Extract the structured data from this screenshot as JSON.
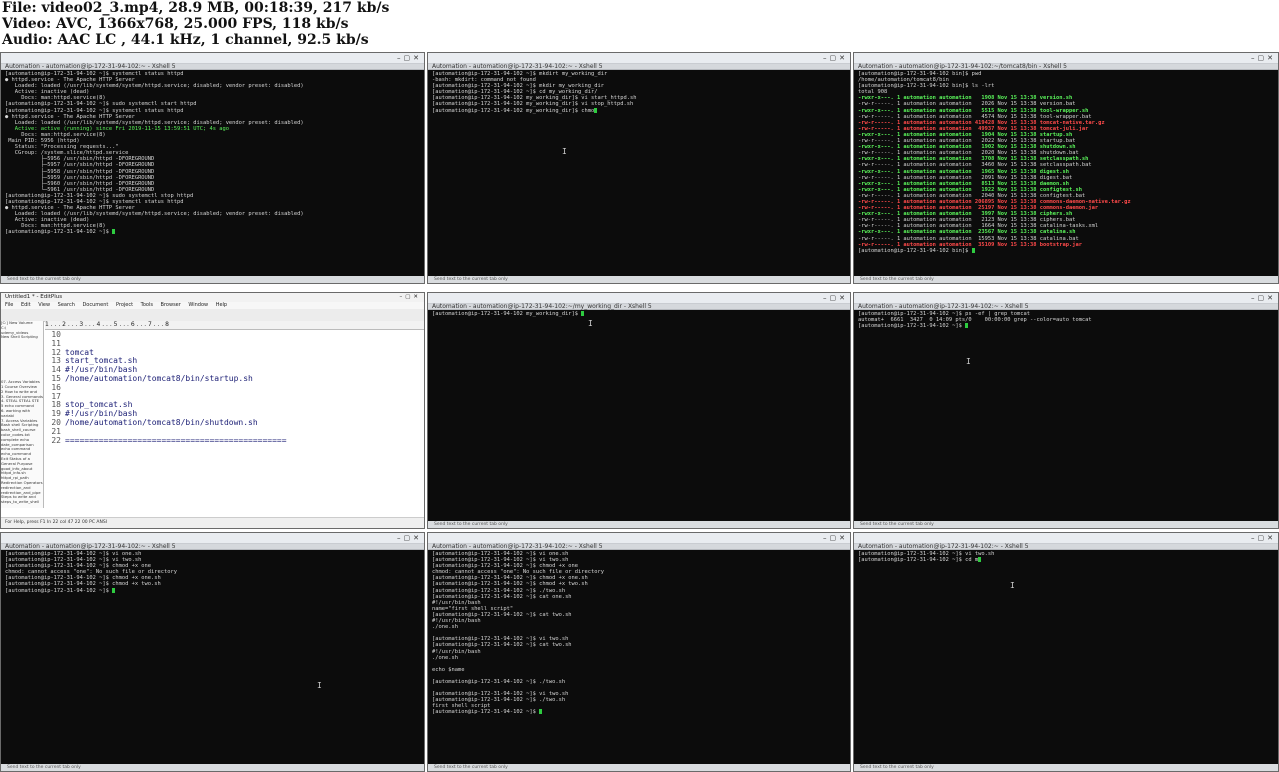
{
  "header": {
    "file_line": "File: video02_3.mp4, 28.9 MB, 00:18:39, 217 kb/s",
    "video_line": "Video: AVC, 1366x768, 25.000 FPS, 118 kb/s",
    "audio_line": "Audio: AAC LC , 44.1 kHz, 1 channel, 92.5 kb/s"
  },
  "tiles": {
    "t1": {
      "title": "Automation - automation@ip-172-31-94-102:~ - Xshell 5",
      "lines": [
        "[automation@ip-172-31-94-102 ~]$ systemctl status httpd",
        "● httpd.service - The Apache HTTP Server",
        "   Loaded: loaded (/usr/lib/systemd/system/httpd.service; disabled; vendor preset: disabled)",
        "   Active: inactive (dead)",
        "     Docs: man:httpd.service(8)",
        "[automation@ip-172-31-94-102 ~]$ sudo systemctl start httpd",
        "[automation@ip-172-31-94-102 ~]$ systemctl status httpd",
        "● httpd.service - The Apache HTTP Server",
        "   Loaded: loaded (/usr/lib/systemd/system/httpd.service; disabled; vendor preset: disabled)",
        "   Active: active (running) since Fri 2019-11-15 13:59:51 UTC; 4s ago",
        "     Docs: man:httpd.service(8)",
        " Main PID: 5956 (httpd)",
        "   Status: \"Processing requests...\"",
        "   CGroup: /system.slice/httpd.service",
        "           ├─5956 /usr/sbin/httpd -DFOREGROUND",
        "           ├─5957 /usr/sbin/httpd -DFOREGROUND",
        "           ├─5958 /usr/sbin/httpd -DFOREGROUND",
        "           ├─5959 /usr/sbin/httpd -DFOREGROUND",
        "           ├─5960 /usr/sbin/httpd -DFOREGROUND",
        "           └─5961 /usr/sbin/httpd -DFOREGROUND",
        "[automation@ip-172-31-94-102 ~]$ sudo systemctl stop httpd",
        "[automation@ip-172-31-94-102 ~]$ systemctl status httpd",
        "● httpd.service - The Apache HTTP Server",
        "   Loaded: loaded (/usr/lib/systemd/system/httpd.service; disabled; vendor preset: disabled)",
        "   Active: inactive (dead)",
        "     Docs: man:httpd.service(8)",
        "[automation@ip-172-31-94-102 ~]$ "
      ],
      "status": "Send text to the current tab only"
    },
    "t2": {
      "title": "Automation - automation@ip-172-31-94-102:~ - Xshell 5",
      "lines": [
        "[automation@ip-172-31-94-102 ~]$ mkdirt my_working_dir",
        "-bash: mkdirt: command not found",
        "[automation@ip-172-31-94-102 ~]$ mkdir my_working_dir",
        "[automation@ip-172-31-94-102 ~]$ cd my_working_dir/",
        "[automation@ip-172-31-94-102 my_working_dir]$ vi start_httpd.sh",
        "[automation@ip-172-31-94-102 my_working_dir]$ vi stop_httpd.sh",
        "[automation@ip-172-31-94-102 my_working_dir]$ chmo"
      ],
      "status": "Send text to the current tab only"
    },
    "t3": {
      "title": "Automation - automation@ip-172-31-94-102:~/tomcat8/bin - Xshell 5",
      "lines": [
        "[automation@ip-172-31-94-102 bin]$ pwd",
        "/home/automation/tomcat8/bin",
        "[automation@ip-172-31-94-102 bin]$ ls -lrt",
        "total 908",
        "-rwxr-x---. 1 automation automation   1908 Nov 15 13:38 version.sh",
        "-rw-r-----. 1 automation automation   2026 Nov 15 13:38 version.bat",
        "-rwxr-x---. 1 automation automation   5515 Nov 15 13:38 tool-wrapper.sh",
        "-rw-r-----. 1 automation automation   4574 Nov 15 13:38 tool-wrapper.bat",
        "-rw-r-----. 1 automation automation 419428 Nov 15 13:38 tomcat-native.tar.gz",
        "-rw-r-----. 1 automation automation  49937 Nov 15 13:38 tomcat-juli.jar",
        "-rwxr-x---. 1 automation automation   1904 Nov 15 13:38 startup.sh",
        "-rw-r-----. 1 automation automation   2022 Nov 15 13:38 startup.bat",
        "-rwxr-x---. 1 automation automation   1902 Nov 15 13:38 shutdown.sh",
        "-rw-r-----. 1 automation automation   2020 Nov 15 13:38 shutdown.bat",
        "-rwxr-x---. 1 automation automation   3708 Nov 15 13:38 setclasspath.sh",
        "-rw-r-----. 1 automation automation   3460 Nov 15 13:38 setclasspath.bat",
        "-rwxr-x---. 1 automation automation   1965 Nov 15 13:38 digest.sh",
        "-rw-r-----. 1 automation automation   2091 Nov 15 13:38 digest.bat",
        "-rwxr-x---. 1 automation automation   8513 Nov 15 13:38 daemon.sh",
        "-rwxr-x---. 1 automation automation   1922 Nov 15 13:38 configtest.sh",
        "-rw-r-----. 1 automation automation   2040 Nov 15 13:38 configtest.bat",
        "-rw-r-----. 1 automation automation 206895 Nov 15 13:38 commons-daemon-native.tar.gz",
        "-rw-r-----. 1 automation automation  25197 Nov 15 13:38 commons-daemon.jar",
        "-rwxr-x---. 1 automation automation   3997 Nov 15 13:38 ciphers.sh",
        "-rw-r-----. 1 automation automation   2123 Nov 15 13:38 ciphers.bat",
        "-rw-r-----. 1 automation automation   1664 Nov 15 13:38 catalina-tasks.xml",
        "-rwxr-x---. 1 automation automation  23567 Nov 15 13:38 catalina.sh",
        "-rw-r-----. 1 automation automation  15953 Nov 15 13:38 catalina.bat",
        "-rw-r-----. 1 automation automation  35109 Nov 15 13:38 bootstrap.jar",
        "[automation@ip-172-31-94-102 bin]$ "
      ],
      "status": "Send text to the current tab only"
    },
    "t4": {
      "window_title": "Untitled1 * - EditPlus",
      "menu": "File Edit View Search Document Project Tools Browser Window Help",
      "dir_items": [
        "[C:] New Volume",
        "C:\\",
        "udemy_videos",
        "New Shell Scripting"
      ],
      "ruler": "1 . . . 2 . . . 3 . . . 4 . . . 5 . . . 6 . . . 7 . . . 8",
      "line_numbers": [
        "10",
        "11",
        "12",
        "13",
        "14",
        "15",
        "16",
        "17",
        "18",
        "19",
        "20",
        "21",
        "22"
      ],
      "code_lines": [
        "",
        "",
        "tomcat",
        "start_tomcat.sh",
        "#!/usr/bin/bash",
        "/home/automation/tomcat8/bin/startup.sh",
        "",
        "",
        "stop_tomcat.sh",
        "#!/usr/bin/bash",
        "/home/automation/tomcat8/bin/shutdown.sh",
        "",
        "=============================================="
      ],
      "file_list": [
        "07. Access Variables",
        "1 Course Overview",
        "2 How to write and",
        "3. General commands",
        "4. STEAL STEAL STE",
        "5 echo command",
        "6. working with variabl",
        "7. Access Variables",
        "Bash shell Scripting",
        "bash_shell_course",
        "color_codes.txt",
        "complete echo",
        "date_comparison",
        "echo command",
        "echo_command",
        "Exit Status of a",
        "General Purpose",
        "good_info_about",
        "httpd_info.sh",
        "httpd_rpi_path",
        "Redirection Operators",
        "redirection_and",
        "redirection_and_pipe",
        "Steps to write and",
        "steps_to_write_shell"
      ],
      "status": "For Help, press F1      In 22   col 47   22   00   PC   ANSI"
    },
    "t5": {
      "title": "Automation - automation@ip-172-31-94-102:~/my_working_dir - Xshell 5",
      "lines": [
        "[automation@ip-172-31-94-102 my_working_dir]$ "
      ],
      "status": "Send text to the current tab only"
    },
    "t6": {
      "title": "Automation - automation@ip-172-31-94-102:~ - Xshell 5",
      "lines": [
        "[automation@ip-172-31-94-102 ~]$ ps -ef | grep tomcat",
        "automat+  6661  3427  0 14:09 pts/0    00:00:00 grep --color=auto tomcat",
        "[automation@ip-172-31-94-102 ~]$ "
      ],
      "status": "Send text to the current tab only"
    },
    "t7": {
      "title": "Automation - automation@ip-172-31-94-102:~ - Xshell 5",
      "lines": [
        "[automation@ip-172-31-94-102 ~]$ vi one.sh",
        "[automation@ip-172-31-94-102 ~]$ vi two.sh",
        "[automation@ip-172-31-94-102 ~]$ chmod +x one",
        "chmod: cannot access \"one\": No such file or directory",
        "[automation@ip-172-31-94-102 ~]$ chmod +x one.sh",
        "[automation@ip-172-31-94-102 ~]$ chmod +x two.sh",
        "[automation@ip-172-31-94-102 ~]$ "
      ],
      "status": "Send text to the current tab only"
    },
    "t8": {
      "title": "Automation - automation@ip-172-31-94-102:~ - Xshell 5",
      "lines": [
        "[automation@ip-172-31-94-102 ~]$ vi one.sh",
        "[automation@ip-172-31-94-102 ~]$ vi two.sh",
        "[automation@ip-172-31-94-102 ~]$ chmod +x one",
        "chmod: cannot access \"one\": No such file or directory",
        "[automation@ip-172-31-94-102 ~]$ chmod +x one.sh",
        "[automation@ip-172-31-94-102 ~]$ chmod +x two.sh",
        "[automation@ip-172-31-94-102 ~]$ ./two.sh",
        "[automation@ip-172-31-94-102 ~]$ cat one.sh",
        "#!/usr/bin/bash",
        "name=\"first shell script\"",
        "[automation@ip-172-31-94-102 ~]$ cat two.sh",
        "#!/usr/bin/bash",
        "./one.sh",
        "",
        "[automation@ip-172-31-94-102 ~]$ vi two.sh",
        "[automation@ip-172-31-94-102 ~]$ cat two.sh",
        "#!/usr/bin/bash",
        "./one.sh",
        "",
        "echo $name",
        "",
        "[automation@ip-172-31-94-102 ~]$ ./two.sh",
        "",
        "[automation@ip-172-31-94-102 ~]$ vi two.sh",
        "[automation@ip-172-31-94-102 ~]$ ./two.sh",
        "first shell script",
        "[automation@ip-172-31-94-102 ~]$ "
      ],
      "status": "Send text to the current tab only"
    },
    "t9": {
      "title": "Automation - automation@ip-172-31-94-102:~ - Xshell 5",
      "lines": [
        "[automation@ip-172-31-94-102 ~]$ vi two.sh",
        "[automation@ip-172-31-94-102 ~]$ cd m"
      ],
      "status": "Send text to the current tab only"
    }
  },
  "colors": {
    "terminal_bg": "#0c0c0c",
    "terminal_fg": "#d6d6d6",
    "cursor": "#2ecc40",
    "exec_green": "#5af25a",
    "archive_red": "#ff4a4a"
  }
}
